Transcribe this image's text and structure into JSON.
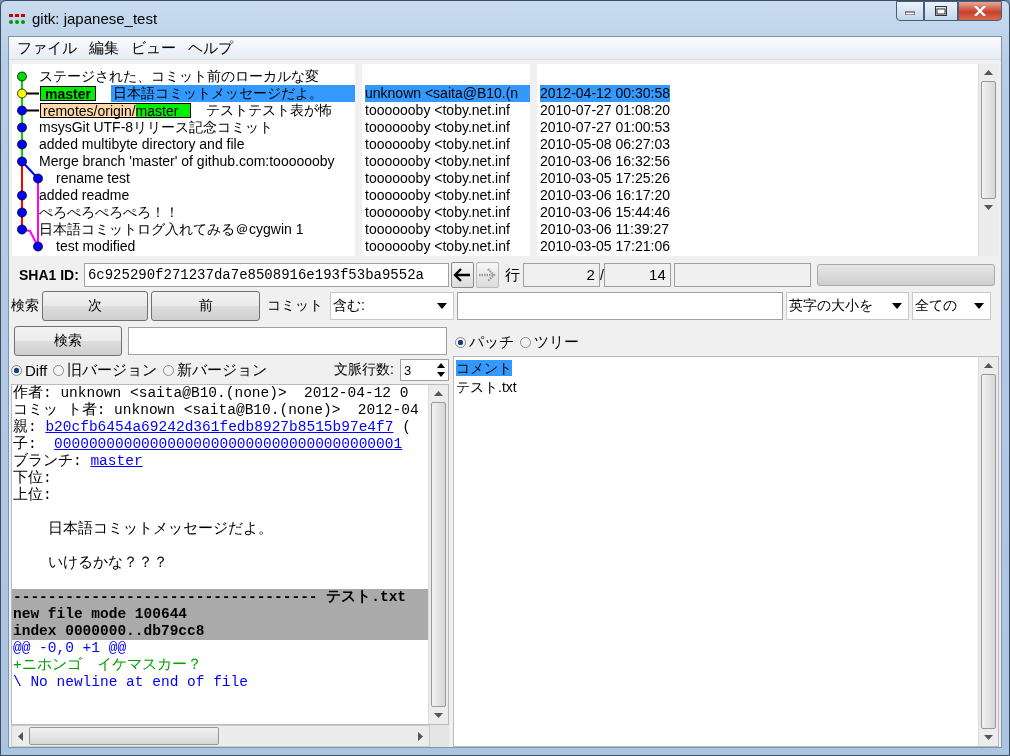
{
  "window": {
    "title": "gitk: japanese_test"
  },
  "menu": [
    "ファイル",
    "編集",
    "ビュー",
    "ヘルプ"
  ],
  "commits": [
    {
      "subject": "ステージされた、コミット前のローカルな変",
      "kind": "mainline",
      "color": "#00dd00",
      "selected": false
    },
    {
      "subject": "日本語コミットメッセージだよ。",
      "author": "unknown <saita@B10.(n",
      "date": "2012-04-12 00:30:58",
      "kind": "mainline",
      "color": "#ffff00",
      "selected": true,
      "refs": [
        {
          "kind": "head",
          "name": "master"
        }
      ]
    },
    {
      "subject": "テストテスト表が怖",
      "author": "tooooooby <toby.net.inf",
      "date": "2010-07-27 01:08:20",
      "kind": "mainline",
      "color": "#0000ff",
      "selected": false,
      "refs": [
        {
          "kind": "remote",
          "prefix": "remotes/origin/",
          "name": "master"
        }
      ]
    },
    {
      "subject": "msysGit UTF-8リリース記念コミット",
      "author": "tooooooby <toby.net.inf",
      "date": "2010-07-27 01:00:53",
      "kind": "mainline",
      "color": "#0000ff",
      "selected": false
    },
    {
      "subject": "added multibyte directory and file",
      "author": "tooooooby <toby.net.inf",
      "date": "2010-05-08 06:27:03",
      "kind": "mainline",
      "color": "#0000ff",
      "selected": false
    },
    {
      "subject": "Merge branch 'master' of github.com:tooooooby",
      "author": "tooooooby <toby.net.inf",
      "date": "2010-03-06 16:32:56",
      "kind": "mainline",
      "color": "#0000ff",
      "selected": false
    },
    {
      "subject": "rename test",
      "author": "tooooooby <toby.net.inf",
      "date": "2010-03-05 17:25:26",
      "kind": "side",
      "color": "#0000ff",
      "selected": false
    },
    {
      "subject": "added readme",
      "author": "tooooooby <toby.net.inf",
      "date": "2010-03-06 16:17:20",
      "kind": "mainline",
      "color": "#0000ff",
      "selected": false
    },
    {
      "subject": "ぺろぺろぺろぺろ！！",
      "author": "tooooooby <toby.net.inf",
      "date": "2010-03-06 15:44:46",
      "kind": "mainline",
      "color": "#0000ff",
      "selected": false
    },
    {
      "subject": "日本語コミットログ入れてみる＠cygwin 1",
      "author": "tooooooby <toby.net.inf",
      "date": "2010-03-06 11:39:27",
      "kind": "mainline",
      "color": "#0000ff",
      "selected": false
    },
    {
      "subject": "test modified",
      "author": "tooooooby <toby.net.inf",
      "date": "2010-03-05 17:21:06",
      "kind": "side",
      "color": "#0000ff",
      "selected": false
    }
  ],
  "sha": {
    "label": "SHA1 ID:",
    "value": "6c925290f271237da7e8508916e193f53ba9552a",
    "row_label": "行",
    "row": "2",
    "separator": "/",
    "total": "14"
  },
  "progress": {
    "level": 0
  },
  "nav_buttons": [
    {
      "kind": "back",
      "disabled": false
    },
    {
      "kind": "forward",
      "disabled": true
    }
  ],
  "find": {
    "label": "検索",
    "next": "次",
    "prev": "前",
    "commit_label": "コミット",
    "mode": "含む:",
    "case": "英字の大小を",
    "scope": "全ての"
  },
  "search": {
    "button": "検索"
  },
  "diff_view": [
    {
      "label": "Diff",
      "selected": true
    },
    {
      "label": "旧バージョン",
      "selected": false
    },
    {
      "label": "新バージョン",
      "selected": false
    }
  ],
  "context": {
    "label": "文脈行数:",
    "value": "3"
  },
  "diff_lines": [
    {
      "kind": "meta",
      "text": "作者: unknown <saita@B10.(none)>  2012-04-12 0"
    },
    {
      "kind": "meta",
      "text": "コミッ ト者: unknown <saita@B10.(none)>  2012-04"
    },
    {
      "kind": "link",
      "label": "親: ",
      "link": "b20cfb6454a69242d361fedb8927b8515b97e4f7",
      "after": " ("
    },
    {
      "kind": "link",
      "label": "子:  ",
      "link": "0000000000000000000000000000000000000001"
    },
    {
      "kind": "link",
      "label": "ブランチ: ",
      "link": "master"
    },
    {
      "kind": "meta",
      "text": "下位:"
    },
    {
      "kind": "meta",
      "text": "上位:"
    },
    {
      "kind": "blank"
    },
    {
      "kind": "meta",
      "text": "    日本語コミットメッセージだよ。"
    },
    {
      "kind": "blank"
    },
    {
      "kind": "meta",
      "text": "    いけるかな？？？"
    },
    {
      "kind": "blank"
    },
    {
      "kind": "file",
      "text": "----------------------------------- テスト.txt"
    },
    {
      "kind": "file",
      "text": "new file mode 100644"
    },
    {
      "kind": "file",
      "text": "index 0000000..db79cc8"
    },
    {
      "kind": "hunk",
      "text": "@@ -0,0 +1 @@"
    },
    {
      "kind": "add",
      "text": "+ニホンゴ　イケマスカー？"
    },
    {
      "kind": "hunk",
      "text": "\\ No newline at end of file"
    }
  ],
  "file_view": [
    {
      "label": "パッチ",
      "selected": true
    },
    {
      "label": "ツリー",
      "selected": false
    }
  ],
  "files": [
    {
      "name": "コメント",
      "selected": true
    },
    {
      "name": "テスト.txt",
      "selected": false
    }
  ]
}
